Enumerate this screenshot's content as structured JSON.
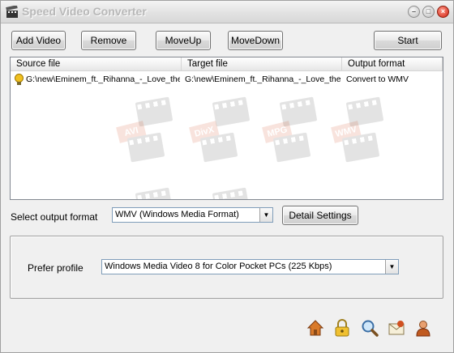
{
  "window": {
    "title": "Speed Video Converter",
    "controls": {
      "minimize": "–",
      "restore": "□",
      "close": "×"
    }
  },
  "toolbar": {
    "add_video": "Add Video",
    "remove": "Remove",
    "move_up": "MoveUp",
    "move_down": "MoveDown",
    "start": "Start"
  },
  "file_list": {
    "columns": [
      "Source file",
      "Target file",
      "Output format"
    ],
    "rows": [
      {
        "source": "G:\\new\\Eminem_ft._Rihanna_-_Love_the...",
        "target": "G:\\new\\Eminem_ft._Rihanna_-_Love_the...",
        "format": "Convert to WMV"
      }
    ],
    "watermark_labels": [
      "AVI",
      "DivX",
      "MPG",
      "WMV"
    ]
  },
  "output": {
    "label": "Select output format",
    "format_value": "WMV (Windows Media Format)",
    "detail_button": "Detail Settings"
  },
  "profile": {
    "label": "Prefer profile",
    "value": "Windows Media Video 8 for Color Pocket PCs (225 Kbps)"
  },
  "footer_icons": [
    "home-icon",
    "lock-icon",
    "search-icon",
    "mail-icon",
    "user-icon"
  ]
}
